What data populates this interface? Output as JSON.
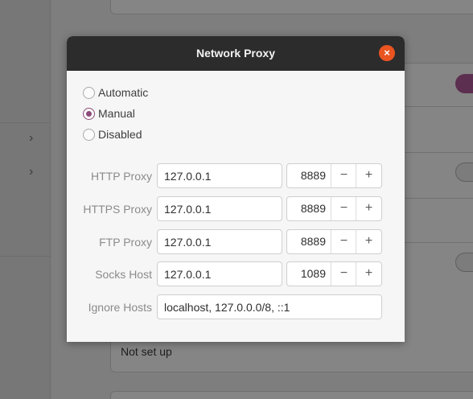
{
  "background": {
    "sidebar_chevrons": [
      "›",
      "›"
    ],
    "status_text": "Not set up"
  },
  "dialog": {
    "title": "Network Proxy",
    "close_glyph": "×",
    "modes": [
      {
        "label": "Automatic",
        "checked": false
      },
      {
        "label": "Manual",
        "checked": true
      },
      {
        "label": "Disabled",
        "checked": false
      }
    ],
    "proxies": [
      {
        "label": "HTTP Proxy",
        "host": "127.0.0.1",
        "port": "8889"
      },
      {
        "label": "HTTPS Proxy",
        "host": "127.0.0.1",
        "port": "8889"
      },
      {
        "label": "FTP Proxy",
        "host": "127.0.0.1",
        "port": "8889"
      },
      {
        "label": "Socks Host",
        "host": "127.0.0.1",
        "port": "1089"
      }
    ],
    "spin_minus": "−",
    "spin_plus": "+",
    "ignore_hosts": {
      "label": "Ignore Hosts",
      "value": "localhost, 127.0.0.0/8, ::1"
    }
  },
  "colors": {
    "accent": "#8e4a7a",
    "close_button": "#e95420",
    "titlebar": "#2c2c2c"
  }
}
